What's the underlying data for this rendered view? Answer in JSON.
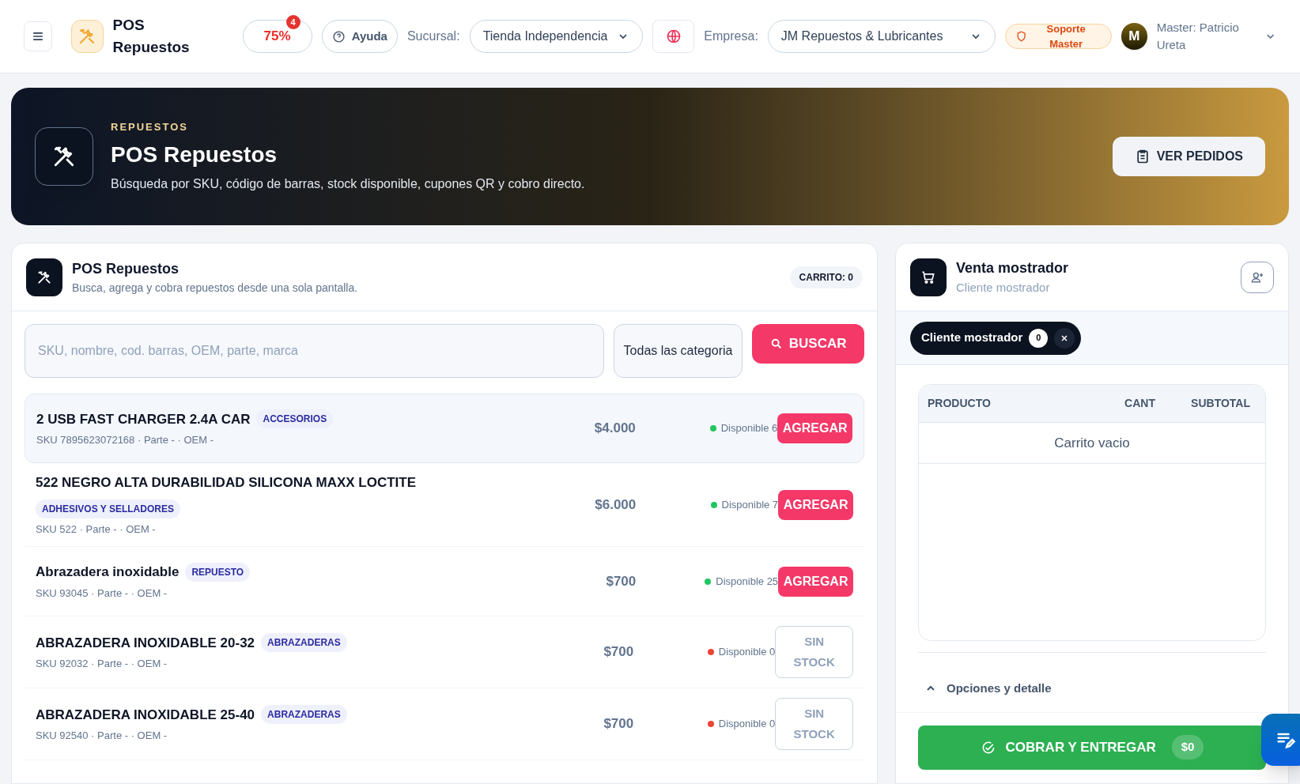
{
  "topbar": {
    "app_title": "POS Repuestos",
    "progress": "75%",
    "progress_badge": "4",
    "help": "Ayuda",
    "branch_label": "Sucursal:",
    "branch_value": "Tienda Independencia",
    "company_label": "Empresa:",
    "company_value": "JM Repuestos & Lubricantes",
    "support": "Soporte Master",
    "avatar": "M",
    "user": "Master: Patricio Ureta"
  },
  "hero": {
    "eyebrow": "REPUESTOS",
    "title": "POS Repuestos",
    "subtitle": "Búsqueda por SKU, código de barras, stock disponible, cupones QR y cobro directo.",
    "button": "VER PEDIDOS"
  },
  "catalog": {
    "title": "POS Repuestos",
    "subtitle": "Busca, agrega y cobra repuestos desde una sola pantalla.",
    "cart_badge": "CARRITO: 0",
    "search_placeholder": "SKU, nombre, cod. barras, OEM, parte, marca",
    "category": "Todas las categoria",
    "search_button": "BUSCAR",
    "products": [
      {
        "name": "2 USB FAST CHARGER 2.4A CAR",
        "tag": "ACCESORIOS",
        "meta": "SKU 7895623072168 · Parte - · OEM -",
        "price": "$4.000",
        "stock": "Disponible 6",
        "available": true,
        "selected": true,
        "action": "AGREGAR"
      },
      {
        "name": "522 NEGRO ALTA DURABILIDAD SILICONA MAXX LOCTITE",
        "tag": "ADHESIVOS Y SELLADORES",
        "meta": "SKU 522 · Parte - · OEM -",
        "price": "$6.000",
        "stock": "Disponible 7",
        "available": true,
        "selected": false,
        "action": "AGREGAR"
      },
      {
        "name": "Abrazadera inoxidable",
        "tag": "REPUESTO",
        "meta": "SKU 93045 · Parte - · OEM -",
        "price": "$700",
        "stock": "Disponible 25",
        "available": true,
        "selected": false,
        "action": "AGREGAR"
      },
      {
        "name": "ABRAZADERA INOXIDABLE 20-32",
        "tag": "ABRAZADERAS",
        "meta": "SKU 92032 · Parte - · OEM -",
        "price": "$700",
        "stock": "Disponible 0",
        "available": false,
        "selected": false,
        "action": "SIN STOCK"
      },
      {
        "name": "ABRAZADERA INOXIDABLE 25-40",
        "tag": "ABRAZADERAS",
        "meta": "SKU 92540 · Parte - · OEM -",
        "price": "$700",
        "stock": "Disponible 0",
        "available": false,
        "selected": false,
        "action": "SIN STOCK"
      }
    ]
  },
  "sale": {
    "title": "Venta mostrador",
    "subtitle": "Cliente mostrador",
    "client_chip": "Cliente mostrador",
    "client_count": "0",
    "columns": [
      "PRODUCTO",
      "CANT",
      "SUBTOTAL"
    ],
    "empty": "Carrito vacio",
    "options": "Opciones y detalle",
    "checkout": "COBRAR Y ENTREGAR",
    "total": "$0"
  }
}
